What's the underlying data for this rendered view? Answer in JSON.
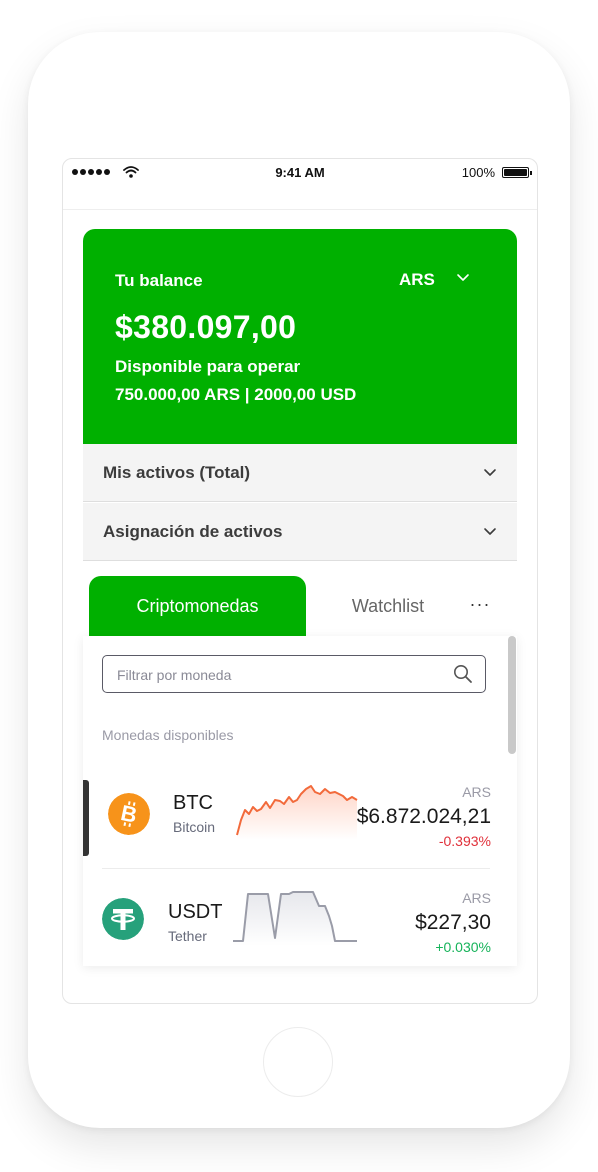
{
  "status_bar": {
    "time": "9:41 AM",
    "battery": "100%"
  },
  "balance": {
    "title": "Tu balance",
    "currency": "ARS",
    "amount": "$380.097,00",
    "available_label": "Disponible para operar",
    "available_values": "750.000,00 ARS | 2000,00 USD"
  },
  "accordions": [
    {
      "label": "Mis activos (Total)"
    },
    {
      "label": "Asignación de activos"
    }
  ],
  "tabs": {
    "active": "Criptomonedas",
    "other": "Watchlist",
    "more": "···"
  },
  "search": {
    "placeholder": "Filtrar por moneda"
  },
  "list": {
    "section_label": "Monedas disponibles",
    "coins": [
      {
        "symbol": "BTC",
        "name": "Bitcoin",
        "currency": "ARS",
        "price": "$6.872.024,21",
        "change": "-0.393%",
        "change_color": "#e0303a",
        "icon": "bitcoin-icon",
        "icon_color": "#f7931a"
      },
      {
        "symbol": "USDT",
        "name": "Tether",
        "currency": "ARS",
        "price": "$227,30",
        "change": "+0.030%",
        "change_color": "#16b35a",
        "icon": "tether-icon",
        "icon_color": "#26a17b"
      }
    ]
  },
  "colors": {
    "brand_green": "#00b000"
  }
}
